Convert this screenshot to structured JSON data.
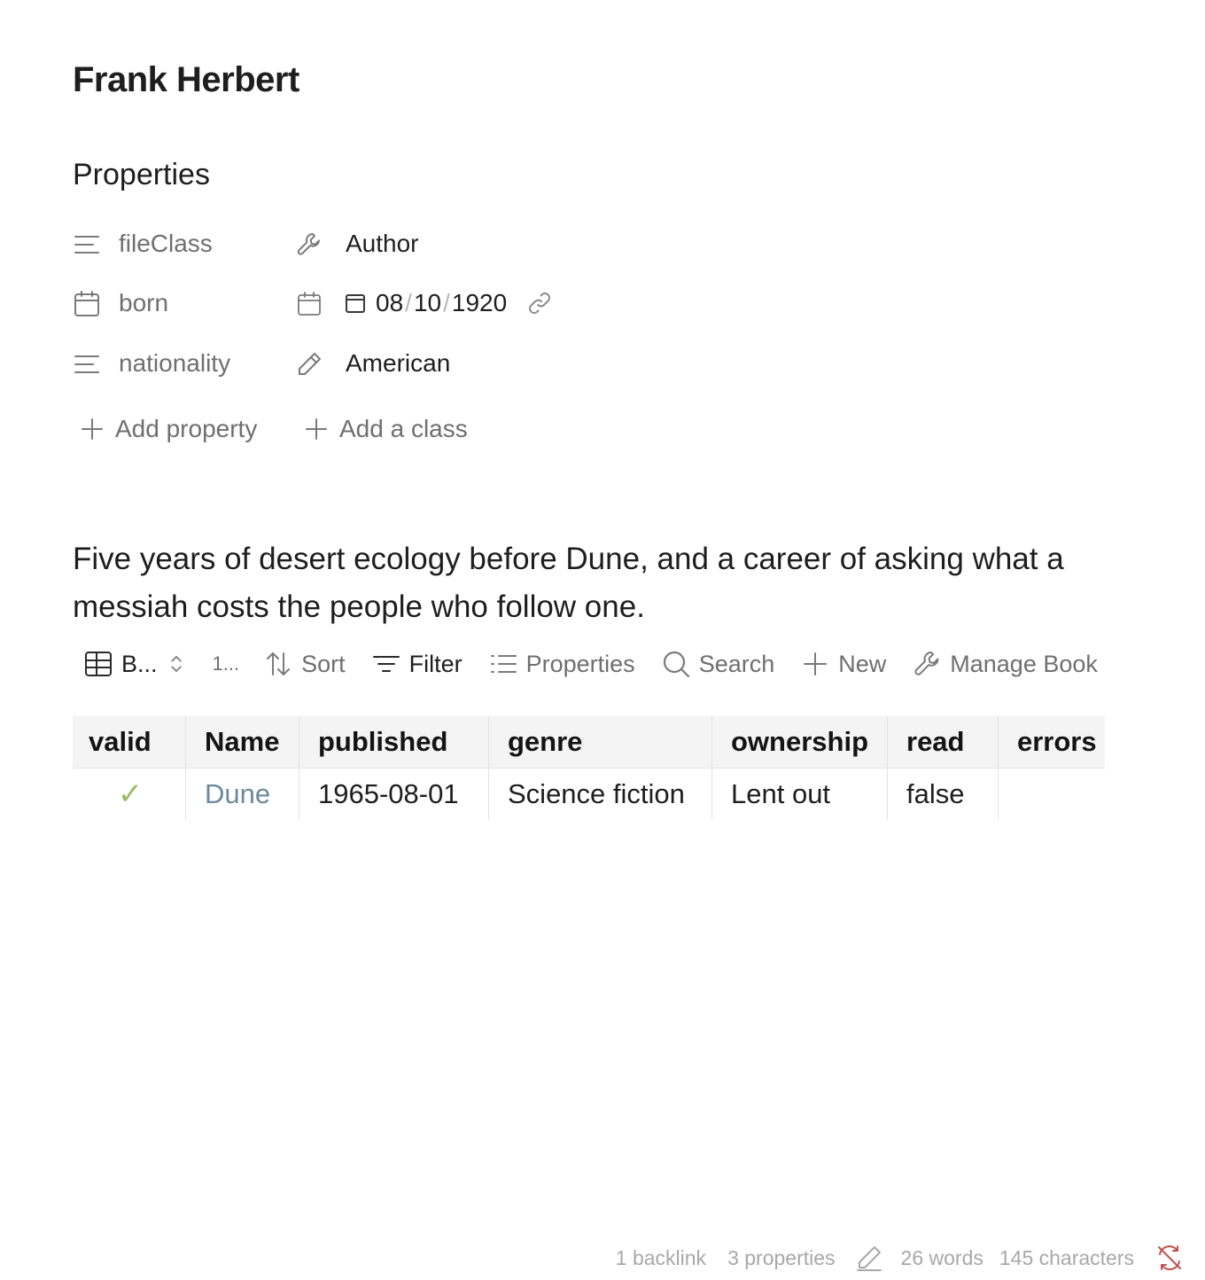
{
  "note": {
    "title": "Frank Herbert",
    "properties_heading": "Properties"
  },
  "properties": [
    {
      "key": "fileClass",
      "key_icon": "text-lines-icon",
      "value_icon": "wrench-icon",
      "value": "Author"
    },
    {
      "key": "born",
      "key_icon": "calendar-icon",
      "value_icon": "calendar-icon",
      "date": {
        "month": "08",
        "day": "10",
        "year": "1920",
        "separator": "/"
      }
    },
    {
      "key": "nationality",
      "key_icon": "text-lines-icon",
      "value_icon": "pencil-icon",
      "value": "American"
    }
  ],
  "actions": {
    "add_property": "Add property",
    "add_class": "Add a class"
  },
  "description": "Five years of desert ecology before Dune, and a career of asking what a messiah costs the people who follow one.",
  "base_toolbar": {
    "view_label": "B...",
    "count_label": "1...",
    "sort": "Sort",
    "filter": "Filter",
    "properties": "Properties",
    "search": "Search",
    "new": "New",
    "manage": "Manage Book"
  },
  "table": {
    "columns": [
      "valid",
      "Name",
      "published",
      "genre",
      "ownership",
      "read",
      "errors"
    ],
    "rows": [
      {
        "valid": "✓",
        "name": "Dune",
        "published": "1965-08-01",
        "genre": "Science fiction",
        "ownership": "Lent out",
        "read": "false",
        "errors": ""
      }
    ]
  },
  "status_bar": {
    "backlinks": "1 backlink",
    "properties": "3 properties",
    "words": "26 words",
    "characters": "145 characters"
  },
  "colors": {
    "valid_check": "#9bbb69",
    "link": "#6c8a9b",
    "sync_error": "#c0504d",
    "muted": "#6f6f6f"
  }
}
